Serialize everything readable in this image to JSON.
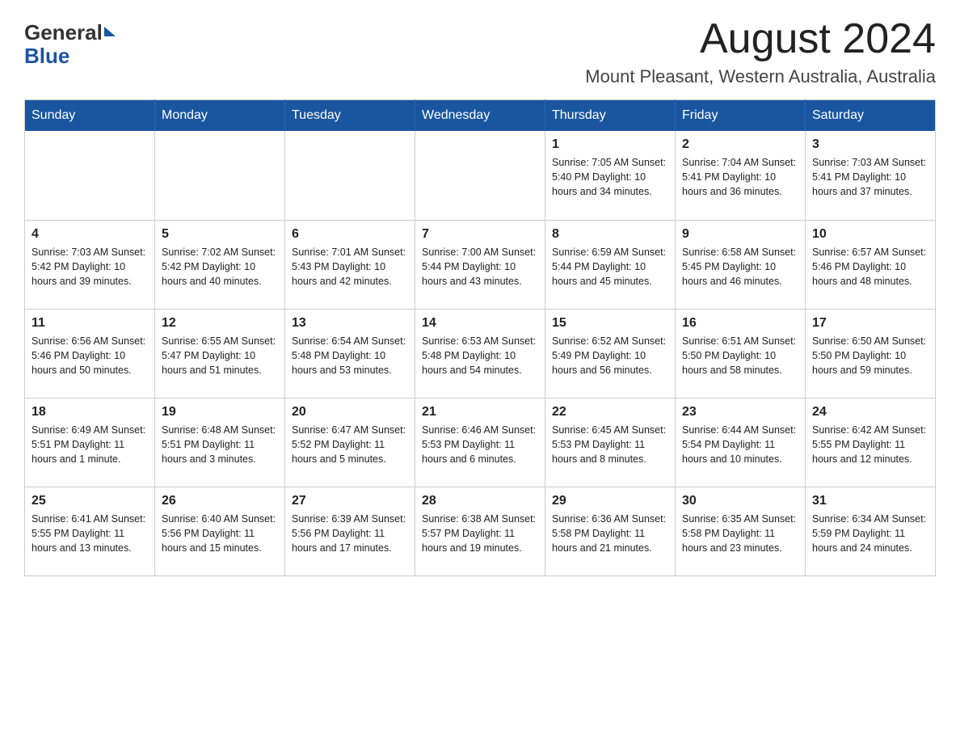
{
  "header": {
    "logo_general": "General",
    "logo_blue": "Blue",
    "month_title": "August 2024",
    "location": "Mount Pleasant, Western Australia, Australia"
  },
  "calendar": {
    "days_of_week": [
      "Sunday",
      "Monday",
      "Tuesday",
      "Wednesday",
      "Thursday",
      "Friday",
      "Saturday"
    ],
    "weeks": [
      [
        {
          "day": "",
          "info": ""
        },
        {
          "day": "",
          "info": ""
        },
        {
          "day": "",
          "info": ""
        },
        {
          "day": "",
          "info": ""
        },
        {
          "day": "1",
          "info": "Sunrise: 7:05 AM\nSunset: 5:40 PM\nDaylight: 10 hours\nand 34 minutes."
        },
        {
          "day": "2",
          "info": "Sunrise: 7:04 AM\nSunset: 5:41 PM\nDaylight: 10 hours\nand 36 minutes."
        },
        {
          "day": "3",
          "info": "Sunrise: 7:03 AM\nSunset: 5:41 PM\nDaylight: 10 hours\nand 37 minutes."
        }
      ],
      [
        {
          "day": "4",
          "info": "Sunrise: 7:03 AM\nSunset: 5:42 PM\nDaylight: 10 hours\nand 39 minutes."
        },
        {
          "day": "5",
          "info": "Sunrise: 7:02 AM\nSunset: 5:42 PM\nDaylight: 10 hours\nand 40 minutes."
        },
        {
          "day": "6",
          "info": "Sunrise: 7:01 AM\nSunset: 5:43 PM\nDaylight: 10 hours\nand 42 minutes."
        },
        {
          "day": "7",
          "info": "Sunrise: 7:00 AM\nSunset: 5:44 PM\nDaylight: 10 hours\nand 43 minutes."
        },
        {
          "day": "8",
          "info": "Sunrise: 6:59 AM\nSunset: 5:44 PM\nDaylight: 10 hours\nand 45 minutes."
        },
        {
          "day": "9",
          "info": "Sunrise: 6:58 AM\nSunset: 5:45 PM\nDaylight: 10 hours\nand 46 minutes."
        },
        {
          "day": "10",
          "info": "Sunrise: 6:57 AM\nSunset: 5:46 PM\nDaylight: 10 hours\nand 48 minutes."
        }
      ],
      [
        {
          "day": "11",
          "info": "Sunrise: 6:56 AM\nSunset: 5:46 PM\nDaylight: 10 hours\nand 50 minutes."
        },
        {
          "day": "12",
          "info": "Sunrise: 6:55 AM\nSunset: 5:47 PM\nDaylight: 10 hours\nand 51 minutes."
        },
        {
          "day": "13",
          "info": "Sunrise: 6:54 AM\nSunset: 5:48 PM\nDaylight: 10 hours\nand 53 minutes."
        },
        {
          "day": "14",
          "info": "Sunrise: 6:53 AM\nSunset: 5:48 PM\nDaylight: 10 hours\nand 54 minutes."
        },
        {
          "day": "15",
          "info": "Sunrise: 6:52 AM\nSunset: 5:49 PM\nDaylight: 10 hours\nand 56 minutes."
        },
        {
          "day": "16",
          "info": "Sunrise: 6:51 AM\nSunset: 5:50 PM\nDaylight: 10 hours\nand 58 minutes."
        },
        {
          "day": "17",
          "info": "Sunrise: 6:50 AM\nSunset: 5:50 PM\nDaylight: 10 hours\nand 59 minutes."
        }
      ],
      [
        {
          "day": "18",
          "info": "Sunrise: 6:49 AM\nSunset: 5:51 PM\nDaylight: 11 hours\nand 1 minute."
        },
        {
          "day": "19",
          "info": "Sunrise: 6:48 AM\nSunset: 5:51 PM\nDaylight: 11 hours\nand 3 minutes."
        },
        {
          "day": "20",
          "info": "Sunrise: 6:47 AM\nSunset: 5:52 PM\nDaylight: 11 hours\nand 5 minutes."
        },
        {
          "day": "21",
          "info": "Sunrise: 6:46 AM\nSunset: 5:53 PM\nDaylight: 11 hours\nand 6 minutes."
        },
        {
          "day": "22",
          "info": "Sunrise: 6:45 AM\nSunset: 5:53 PM\nDaylight: 11 hours\nand 8 minutes."
        },
        {
          "day": "23",
          "info": "Sunrise: 6:44 AM\nSunset: 5:54 PM\nDaylight: 11 hours\nand 10 minutes."
        },
        {
          "day": "24",
          "info": "Sunrise: 6:42 AM\nSunset: 5:55 PM\nDaylight: 11 hours\nand 12 minutes."
        }
      ],
      [
        {
          "day": "25",
          "info": "Sunrise: 6:41 AM\nSunset: 5:55 PM\nDaylight: 11 hours\nand 13 minutes."
        },
        {
          "day": "26",
          "info": "Sunrise: 6:40 AM\nSunset: 5:56 PM\nDaylight: 11 hours\nand 15 minutes."
        },
        {
          "day": "27",
          "info": "Sunrise: 6:39 AM\nSunset: 5:56 PM\nDaylight: 11 hours\nand 17 minutes."
        },
        {
          "day": "28",
          "info": "Sunrise: 6:38 AM\nSunset: 5:57 PM\nDaylight: 11 hours\nand 19 minutes."
        },
        {
          "day": "29",
          "info": "Sunrise: 6:36 AM\nSunset: 5:58 PM\nDaylight: 11 hours\nand 21 minutes."
        },
        {
          "day": "30",
          "info": "Sunrise: 6:35 AM\nSunset: 5:58 PM\nDaylight: 11 hours\nand 23 minutes."
        },
        {
          "day": "31",
          "info": "Sunrise: 6:34 AM\nSunset: 5:59 PM\nDaylight: 11 hours\nand 24 minutes."
        }
      ]
    ]
  }
}
